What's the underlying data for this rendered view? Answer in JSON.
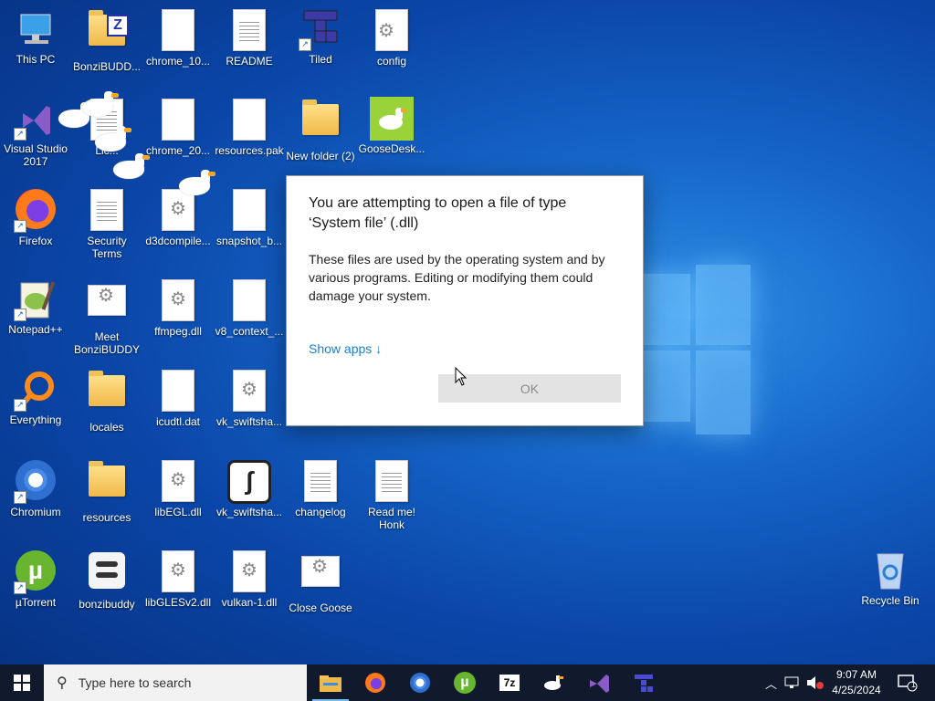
{
  "desktop": {
    "icons": [
      {
        "label": "This PC"
      },
      {
        "label": "BonziBUDD..."
      },
      {
        "label": "chrome_10..."
      },
      {
        "label": "README"
      },
      {
        "label": "Tiled"
      },
      {
        "label": "config"
      },
      {
        "label": "Visual Studio 2017"
      },
      {
        "label": "Lic..."
      },
      {
        "label": "chrome_20..."
      },
      {
        "label": "resources.pak"
      },
      {
        "label": "New folder (2)"
      },
      {
        "label": "GooseDesk..."
      },
      {
        "label": "Firefox"
      },
      {
        "label": "Security Terms"
      },
      {
        "label": "d3dcompile..."
      },
      {
        "label": "snapshot_b..."
      },
      {
        "label": "Notepad++"
      },
      {
        "label": "Meet BonziBUDDY"
      },
      {
        "label": "ffmpeg.dll"
      },
      {
        "label": "v8_context_..."
      },
      {
        "label": "Everything"
      },
      {
        "label": "locales"
      },
      {
        "label": "icudtl.dat"
      },
      {
        "label": "vk_swiftsha..."
      },
      {
        "label": "Chromium"
      },
      {
        "label": "resources"
      },
      {
        "label": "libEGL.dll"
      },
      {
        "label": "vk_swiftsha..."
      },
      {
        "label": "changelog"
      },
      {
        "label": "Read me! Honk"
      },
      {
        "label": "µTorrent"
      },
      {
        "label": "bonzibuddy"
      },
      {
        "label": "libGLESv2.dll"
      },
      {
        "label": "vulkan-1.dll"
      },
      {
        "label": "Close Goose"
      },
      {
        "label": "Recycle Bin"
      }
    ]
  },
  "dialog": {
    "title": "You are attempting to open a file of type ‘System file’ (.dll)",
    "body": "These files are used by the operating system and by various programs. Editing or modifying them could damage your system.",
    "show_apps": "Show apps ↓",
    "ok_label": "OK"
  },
  "taskbar": {
    "search_placeholder": "Type here to search",
    "apps": [
      "file-explorer-icon",
      "firefox-icon",
      "chromium-icon",
      "utorrent-icon",
      "7zip-icon",
      "goose-icon",
      "visual-studio-icon",
      "tiled-icon"
    ],
    "sevenzip_text": "7z",
    "time": "9:07 AM",
    "date": "4/25/2024",
    "notification_count": "1"
  },
  "colors": {
    "desktop_accent": "#1565c8",
    "link": "#1a7fd0",
    "taskbar": "#101a2c"
  }
}
